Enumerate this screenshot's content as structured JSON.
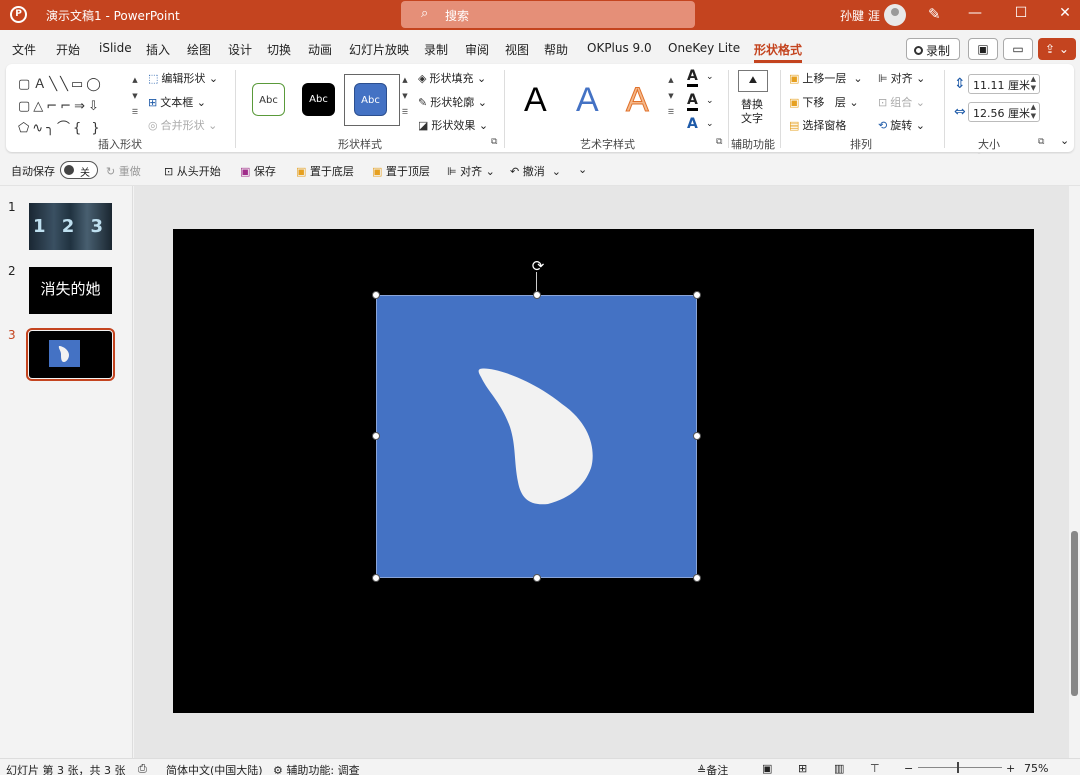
{
  "titlebar": {
    "doc_title": "演示文稿1 - PowerPoint",
    "search_placeholder": "搜索",
    "user_name": "孙腱 涯",
    "minimize": "—",
    "restore": "☐",
    "close": "✕"
  },
  "tabs": [
    "文件",
    "开始",
    "iSlide",
    "插入",
    "绘图",
    "设计",
    "切换",
    "动画",
    "幻灯片放映",
    "录制",
    "审阅",
    "视图",
    "帮助",
    "OKPlus 9.0",
    "OneKey Lite",
    "形状格式"
  ],
  "active_tab": "形状格式",
  "tab_buttons": {
    "record": "录制"
  },
  "ribbon": {
    "insert_shapes": {
      "label": "插入形状",
      "edit_shape": "编辑形状",
      "text_box": "文本框",
      "merge_shapes": "合并形状"
    },
    "shape_styles": {
      "label": "形状样式",
      "chips": [
        "Abc",
        "Abc",
        "Abc"
      ],
      "fill": "形状填充",
      "outline": "形状轮廓",
      "effects": "形状效果"
    },
    "wordart": {
      "label": "艺术字样式",
      "samples": [
        "A",
        "A",
        "A"
      ]
    },
    "accessibility": {
      "label": "辅助功能",
      "alt_text_line1": "替换",
      "alt_text_line2": "文字"
    },
    "arrange": {
      "label": "排列",
      "bring_forward": "上移一层",
      "send_backward": "下移",
      "layer": "层",
      "selection_pane": "选择窗格",
      "align": "对齐",
      "group": "组合",
      "rotate": "旋转"
    },
    "size": {
      "label": "大小",
      "height": "11.11 厘米",
      "width": "12.56 厘米"
    }
  },
  "qat": {
    "autosave": "自动保存",
    "autosave_state": "关",
    "redo": "重做",
    "from_start": "从头开始",
    "save": "保存",
    "send_to_back": "置于底层",
    "bring_to_front": "置于顶层",
    "align": "对齐",
    "undo": "撤消"
  },
  "slides": [
    {
      "number": "1",
      "thumb_text": "1 2 3"
    },
    {
      "number": "2",
      "thumb_text": "消失的她"
    },
    {
      "number": "3",
      "thumb_text": ""
    }
  ],
  "status": {
    "slide_info": "幻灯片 第 3 张，共 3 张",
    "language": "简体中文(中国大陆)",
    "accessibility": "辅助功能: 调查",
    "notes": "备注",
    "zoom_minus": "−",
    "zoom_plus": "+",
    "zoom": "75%"
  },
  "colors": {
    "accent": "#c4441f",
    "shape_fill": "#4472c4",
    "teardrop": "#f2f2f2"
  }
}
